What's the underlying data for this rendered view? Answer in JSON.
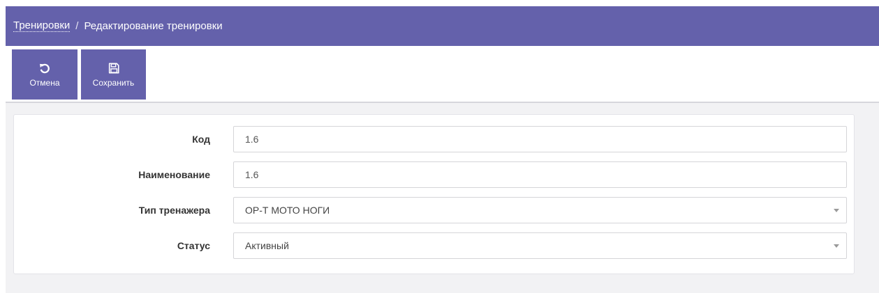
{
  "breadcrumb": {
    "parent": "Тренировки",
    "separator": "/",
    "current": "Редактирование тренировки"
  },
  "toolbar": {
    "cancel_label": "Отмена",
    "cancel_icon": "undo-icon",
    "save_label": "Сохранить",
    "save_icon": "floppy-disk-icon"
  },
  "form": {
    "code": {
      "label": "Код",
      "value": "1.6"
    },
    "name": {
      "label": "Наименование",
      "value": "1.6"
    },
    "trainer_type": {
      "label": "Тип тренажера",
      "value": "ОР-Т МОТО НОГИ"
    },
    "status": {
      "label": "Статус",
      "value": "Активный"
    }
  },
  "colors": {
    "brand": "#6461ab",
    "background": "#f2f2f4"
  }
}
